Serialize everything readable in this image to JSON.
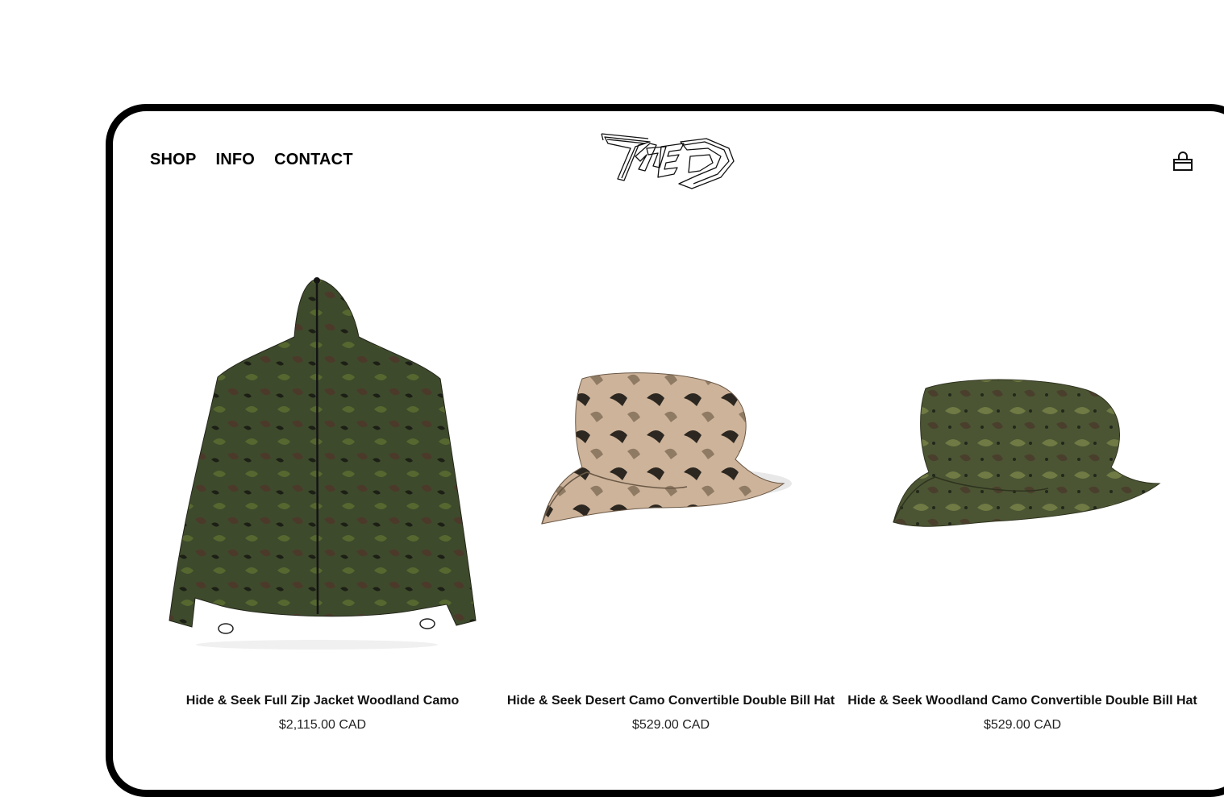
{
  "nav": {
    "items": [
      {
        "label": "SHOP"
      },
      {
        "label": "INFO"
      },
      {
        "label": "CONTACT"
      }
    ]
  },
  "logo": {
    "icon": "graffiti-logo-icon"
  },
  "cart": {
    "icon": "shopping-bag-icon"
  },
  "products": [
    {
      "title": "Hide & Seek Full Zip Jacket Woodland Camo",
      "price": "$2,115.00 CAD",
      "colors": {
        "base": "#3e4a2c",
        "camo1": "#56682f",
        "camo2": "#4b3a2a",
        "dark": "#1c1f15"
      }
    },
    {
      "title": "Hide & Seek Desert Camo Convertible Double Bill Hat",
      "price": "$529.00 CAD",
      "colors": {
        "base": "#cdb39a",
        "camo1": "#8f7a63",
        "camo2": "#2c2720",
        "dark": "#1d1a16"
      }
    },
    {
      "title": "Hide & Seek Woodland Camo Convertible Double Bill Hat",
      "price": "$529.00 CAD",
      "colors": {
        "base": "#4b5533",
        "camo1": "#6f7a44",
        "camo2": "#4a3f2c",
        "dark": "#23261a"
      }
    }
  ]
}
